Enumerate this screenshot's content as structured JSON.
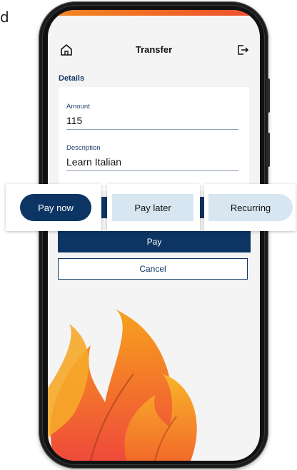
{
  "corner_text": "d",
  "header": {
    "title": "Transfer",
    "home_icon": "home-icon",
    "logout_icon": "logout-icon"
  },
  "details": {
    "section_label": "Details",
    "amount_label": "Amount",
    "amount_value": "115",
    "description_label": "Description",
    "description_value": "Learn Italian"
  },
  "timing_options": {
    "pay_now": "Pay now",
    "pay_later": "Pay later",
    "recurring": "Recurring",
    "selected": "Pay now"
  },
  "actions": {
    "pay_label": "Pay",
    "cancel_label": "Cancel"
  },
  "colors": {
    "primary": "#0d3563",
    "option_bg": "#d7e6f0",
    "accent_top": "#f08a20"
  }
}
